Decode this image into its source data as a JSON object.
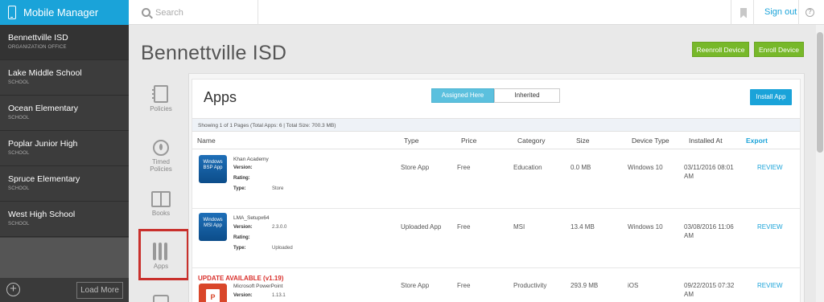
{
  "topbar": {
    "app_title": "Mobile Manager",
    "search_placeholder": "Search",
    "sign_out": "Sign out"
  },
  "sidebar": {
    "items": [
      {
        "name": "Bennettville ISD",
        "type": "ORGANIZATION OFFICE"
      },
      {
        "name": "Lake Middle School",
        "type": "SCHOOL"
      },
      {
        "name": "Ocean Elementary",
        "type": "SCHOOL"
      },
      {
        "name": "Poplar Junior High",
        "type": "SCHOOL"
      },
      {
        "name": "Spruce Elementary",
        "type": "SCHOOL"
      },
      {
        "name": "West High School",
        "type": "SCHOOL"
      }
    ],
    "load_more": "Load More",
    "add_symbol": "+"
  },
  "header": {
    "title": "Bennettville ISD",
    "reenroll": "Reenroll Device",
    "enroll": "Enroll Device"
  },
  "menu": {
    "policies": "Policies",
    "timed_1": "Timed",
    "timed_2": "Policies",
    "books": "Books",
    "apps": "Apps"
  },
  "apps_panel": {
    "title": "Apps",
    "tab_assigned": "Assigned Here",
    "tab_inherited": "Inherited",
    "install": "Install App",
    "showing": "Showing 1 of 1 Pages (Total Apps: 6 | Total Size: 700.3 MB)",
    "columns": {
      "name": "Name",
      "type": "Type",
      "price": "Price",
      "category": "Category",
      "size": "Size",
      "device_type": "Device Type",
      "installed_at": "Installed At",
      "export": "Export"
    },
    "labels": {
      "version": "Version:",
      "rating": "Rating:",
      "type": "Type:",
      "review": "REVIEW"
    },
    "rows": [
      {
        "icon_text": "Windows BSP App",
        "name": "Khan Academy",
        "version": "",
        "meta_type": "Store",
        "type": "Store App",
        "price": "Free",
        "category": "Education",
        "size": "0.0 MB",
        "device_type": "Windows 10",
        "installed_1": "03/11/2016 08:01",
        "installed_2": "AM"
      },
      {
        "icon_text": "Windows MSI App",
        "name": "LMA_Setupx64",
        "version": "2.3.0.0",
        "meta_type": "Uploaded",
        "type": "Uploaded App",
        "price": "Free",
        "category": "MSI",
        "size": "13.4 MB",
        "device_type": "Windows 10",
        "installed_1": "03/08/2016 11:06",
        "installed_2": "AM"
      },
      {
        "update_label": "UPDATE AVAILABLE (v1.19)",
        "icon_letter": "P",
        "name": "Microsoft PowerPoint",
        "version": "1.13.1",
        "type": "Store App",
        "price": "Free",
        "category": "Productivity",
        "size": "293.9 MB",
        "device_type": "iOS",
        "installed_1": "09/22/2015 07:32",
        "installed_2": "AM"
      }
    ]
  },
  "colors": {
    "brand_blue": "#1aa3d9",
    "green": "#77b82a",
    "highlight_red": "#c9302c",
    "sidebar_dark": "#3c3c3c"
  }
}
